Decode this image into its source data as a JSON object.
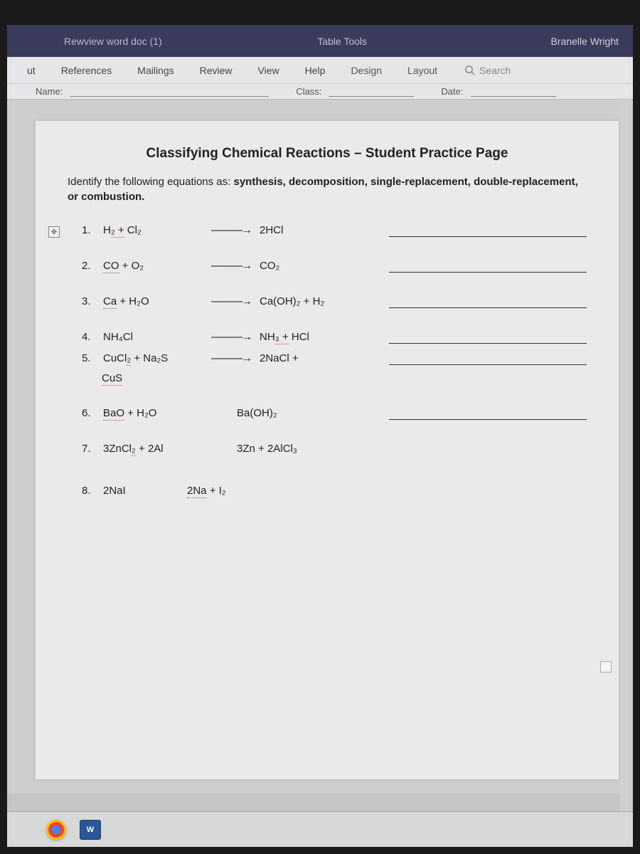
{
  "titleBar": {
    "docName": "Rewview word doc (1)",
    "contextTitle": "Table Tools",
    "userName": "Branelle Wright"
  },
  "ribbon": {
    "tabs": [
      "ut",
      "References",
      "Mailings",
      "Review",
      "View",
      "Help",
      "Design",
      "Layout"
    ],
    "searchLabel": "Search"
  },
  "docFields": {
    "name": "Name:",
    "class": "Class:",
    "date": "Date:"
  },
  "document": {
    "title": "Classifying Chemical Reactions – Student Practice Page",
    "instructions_prefix": "Identify the following equations as: ",
    "instructions_bold": "synthesis, decomposition, single-replacement, double-replacement, or combustion.",
    "questions": [
      {
        "num": "1.",
        "left": "H₂ + Cl₂",
        "right": "2HCl",
        "arrow": "———→"
      },
      {
        "num": "2.",
        "left": "CO + O₂",
        "right": "CO₂",
        "arrow": "———→"
      },
      {
        "num": "3.",
        "left": "Ca + H₂O",
        "right": "Ca(OH)₂ + H₂",
        "arrow": "———→"
      },
      {
        "num": "4.",
        "left": "NH₄Cl",
        "right": "NH₃ + HCl",
        "arrow": "———→"
      },
      {
        "num": "5.",
        "left": "CuCl₂ + Na₂S",
        "right": "2NaCl +",
        "arrow": "———→",
        "sub": "CuS"
      },
      {
        "num": "6.",
        "left": "BaO + H₂O",
        "right": "Ba(OH)₂",
        "arrow": ""
      },
      {
        "num": "7.",
        "left": "3ZnCl₂ + 2Al",
        "right": "3Zn + 2AlCl₃",
        "arrow": ""
      },
      {
        "num": "8.",
        "left": "2NaI",
        "right": "2Na + I₂",
        "arrow": ""
      }
    ]
  }
}
